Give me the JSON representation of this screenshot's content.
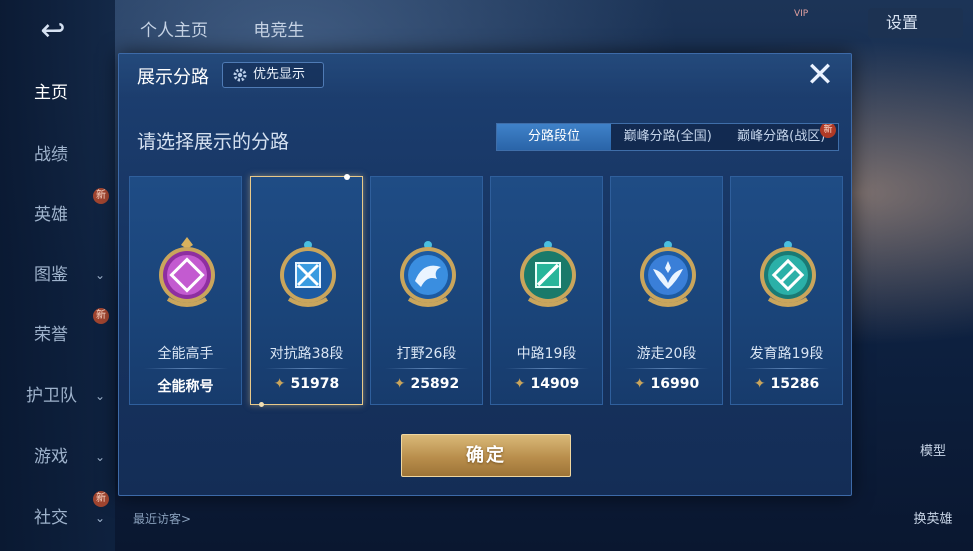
{
  "background": {
    "nav": {
      "back_glyph": "↩",
      "items": [
        {
          "label": "主页",
          "active": true
        },
        {
          "label": "战绩"
        },
        {
          "label": "英雄",
          "new": "新"
        },
        {
          "label": "图鉴",
          "arrow": "⌄"
        },
        {
          "label": "荣誉",
          "new": "新"
        },
        {
          "label": "护卫队",
          "arrow": "⌄"
        },
        {
          "label": "游戏",
          "arrow": "⌄"
        },
        {
          "label": "社交",
          "new": "新",
          "arrow": "⌄"
        }
      ]
    },
    "top_tabs": [
      "个人主页",
      "电竞生"
    ],
    "settings_label": "设置",
    "vip_label": "VIP",
    "right_side": {
      "model_label": "模型",
      "switch_hero_label": "换英雄"
    },
    "recent_visitors_label": "最近访客>"
  },
  "modal": {
    "title": "展示分路",
    "priority_label": "优先显示",
    "close_glyph": "✕",
    "subtitle": "请选择展示的分路",
    "tabs": [
      {
        "label": "分路段位",
        "active": true
      },
      {
        "label": "巅峰分路(全国)"
      },
      {
        "label": "巅峰分路(战区)",
        "new": "新"
      }
    ],
    "cards": [
      {
        "label": "全能高手",
        "foot": "全能称号",
        "has_star": false,
        "color": "#c35bd0"
      },
      {
        "label": "对抗路38段",
        "foot": "51978",
        "has_star": true,
        "selected": true,
        "color": "#3a9be0"
      },
      {
        "label": "打野26段",
        "foot": "25892",
        "has_star": true,
        "color": "#3a8ee0"
      },
      {
        "label": "中路19段",
        "foot": "14909",
        "has_star": true,
        "color": "#28b59a"
      },
      {
        "label": "游走20段",
        "foot": "16990",
        "has_star": true,
        "color": "#3a7fd8"
      },
      {
        "label": "发育路19段",
        "foot": "15286",
        "has_star": true,
        "color": "#2bb0a8"
      }
    ],
    "confirm_label": "确定"
  },
  "colors": {
    "accent_gold": "#c8a45c",
    "modal_bg": "#1a3a68",
    "tab_active": "#3f82c9"
  }
}
